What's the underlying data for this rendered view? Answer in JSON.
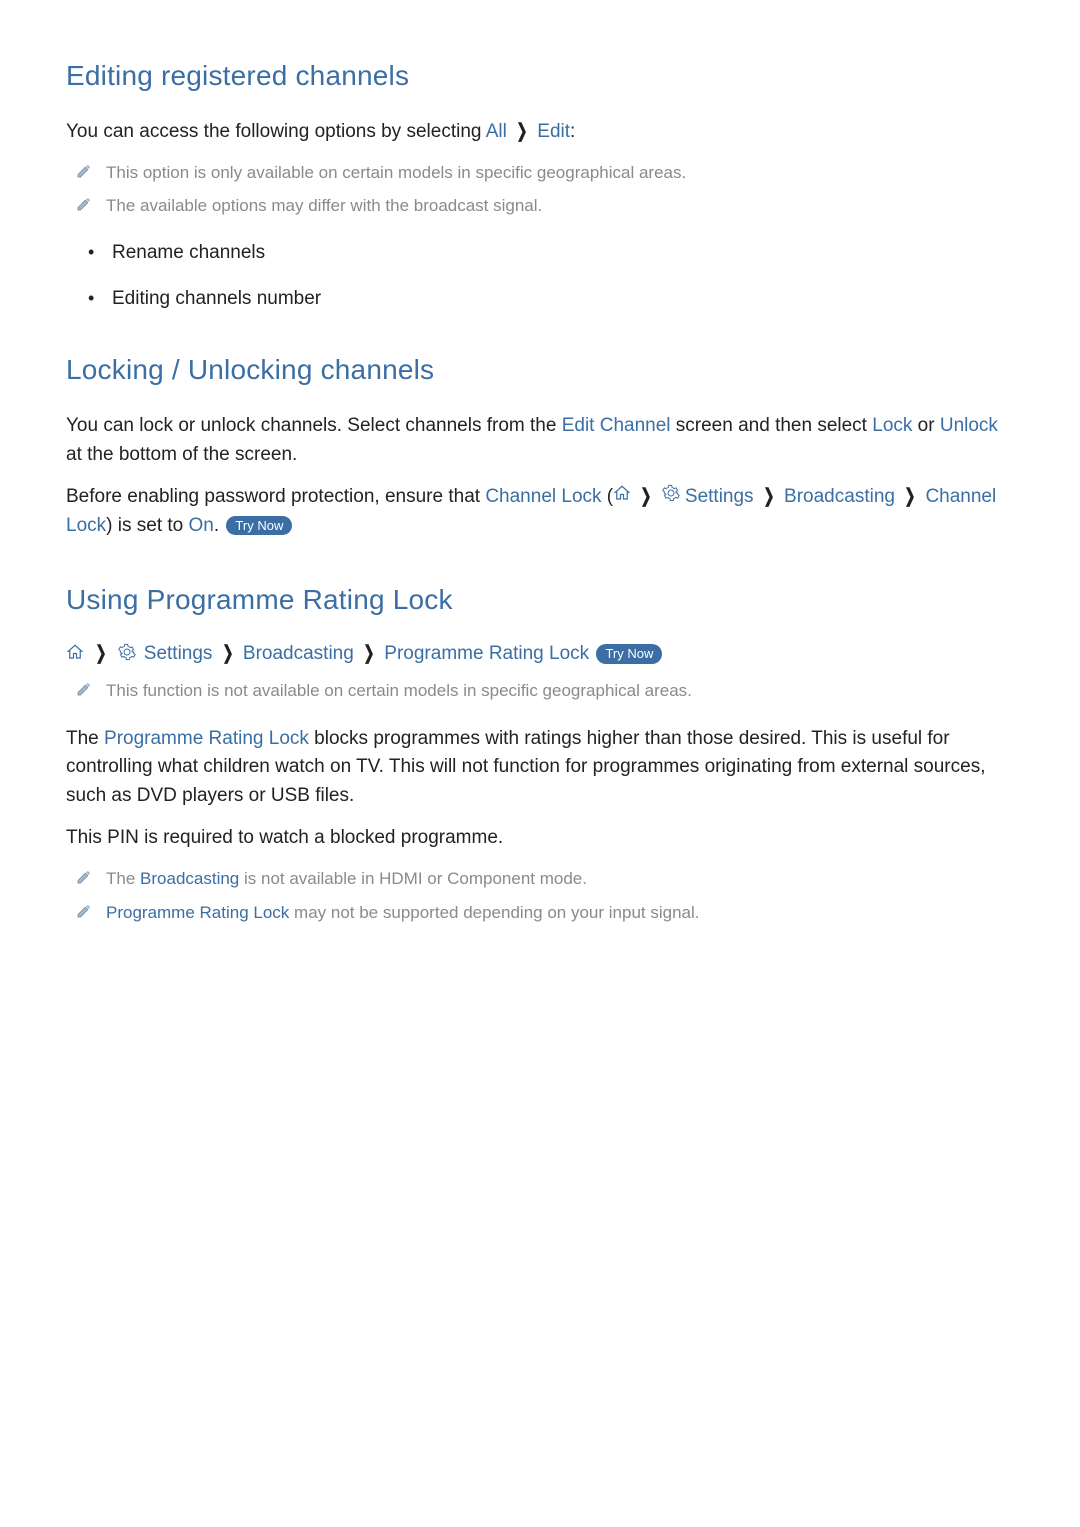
{
  "section1": {
    "heading": "Editing registered channels",
    "intro_prefix": "You can access the following options by selecting ",
    "intro_all": "All",
    "intro_edit": "Edit",
    "intro_suffix": ":",
    "note1": "This option is only available on certain models in specific geographical areas.",
    "note2": "The available options may differ with the broadcast signal.",
    "bullet1": "Rename channels",
    "bullet2": "Editing channels number"
  },
  "section2": {
    "heading": "Locking / Unlocking channels",
    "p1_prefix": "You can lock or unlock channels. Select channels from the ",
    "p1_editchannel": "Edit Channel",
    "p1_mid": " screen and then select ",
    "p1_lock": "Lock",
    "p1_or": " or ",
    "p1_unlock": "Unlock",
    "p1_suffix": " at the bottom of the screen.",
    "p2_prefix": "Before enabling password protection, ensure that ",
    "p2_channellock1": "Channel Lock",
    "p2_open": " (",
    "p2_settings": "Settings",
    "p2_broadcasting": "Broadcasting",
    "p2_channellock2": "Channel Lock",
    "p2_close_is_set_to": ") is set to ",
    "p2_on": "On",
    "p2_period": ". ",
    "trynow": "Try Now"
  },
  "section3": {
    "heading": "Using Programme Rating Lock",
    "path_settings": "Settings",
    "path_broadcasting": "Broadcasting",
    "path_prl": "Programme Rating Lock",
    "trynow": "Try Now",
    "note_unavail": "This function is not available on certain models in specific geographical areas.",
    "p1_the": "The ",
    "p1_prl": "Programme Rating Lock",
    "p1_rest": " blocks programmes with ratings higher than those desired. This is useful for controlling what children watch on TV. This will not function for programmes originating from external sources, such as DVD players or USB files.",
    "p2": "This PIN is required to watch a blocked programme.",
    "note2_the": "The ",
    "note2_broadcasting": "Broadcasting",
    "note2_rest": " is not available in HDMI or Component mode.",
    "note3_prl": "Programme Rating Lock",
    "note3_rest": " may not be supported depending on your input signal."
  }
}
